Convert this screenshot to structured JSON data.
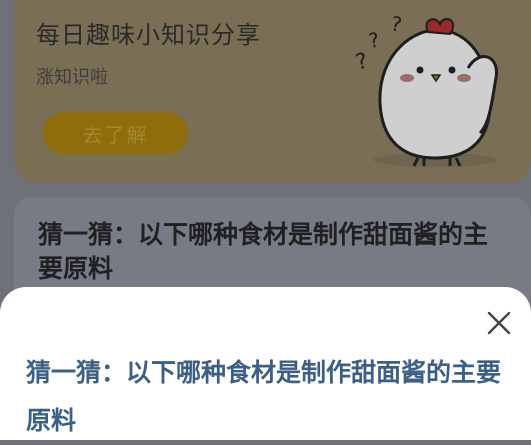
{
  "promo": {
    "title": "每日趣味小知识分享",
    "subtitle": "涨知识啦",
    "button_label": "去了解"
  },
  "quiz_card": {
    "text": "猜一猜：以下哪种食材是制作甜面酱的主要原料"
  },
  "sheet": {
    "text": "猜一猜：以下哪种食材是制作甜面酱的主要原料"
  },
  "icons": {
    "close": "close-icon",
    "mascot": "chick-mascot"
  }
}
